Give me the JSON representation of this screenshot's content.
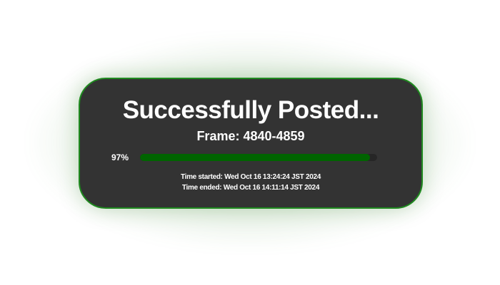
{
  "dialog": {
    "title": "Successfully Posted...",
    "frame_text": "Frame: 4840-4859",
    "progress_label": "97%",
    "progress_value": 0.97,
    "time_started": "Time started: Wed Oct 16 13:24:24 JST 2024",
    "time_ended": "Time ended: Wed Oct 16 14:11:14 JST 2024"
  },
  "colors": {
    "card_bg": "#333333",
    "border": "#1f8a1f",
    "progress_fill": "#006400",
    "progress_track": "#262626",
    "text": "#ffffff"
  }
}
